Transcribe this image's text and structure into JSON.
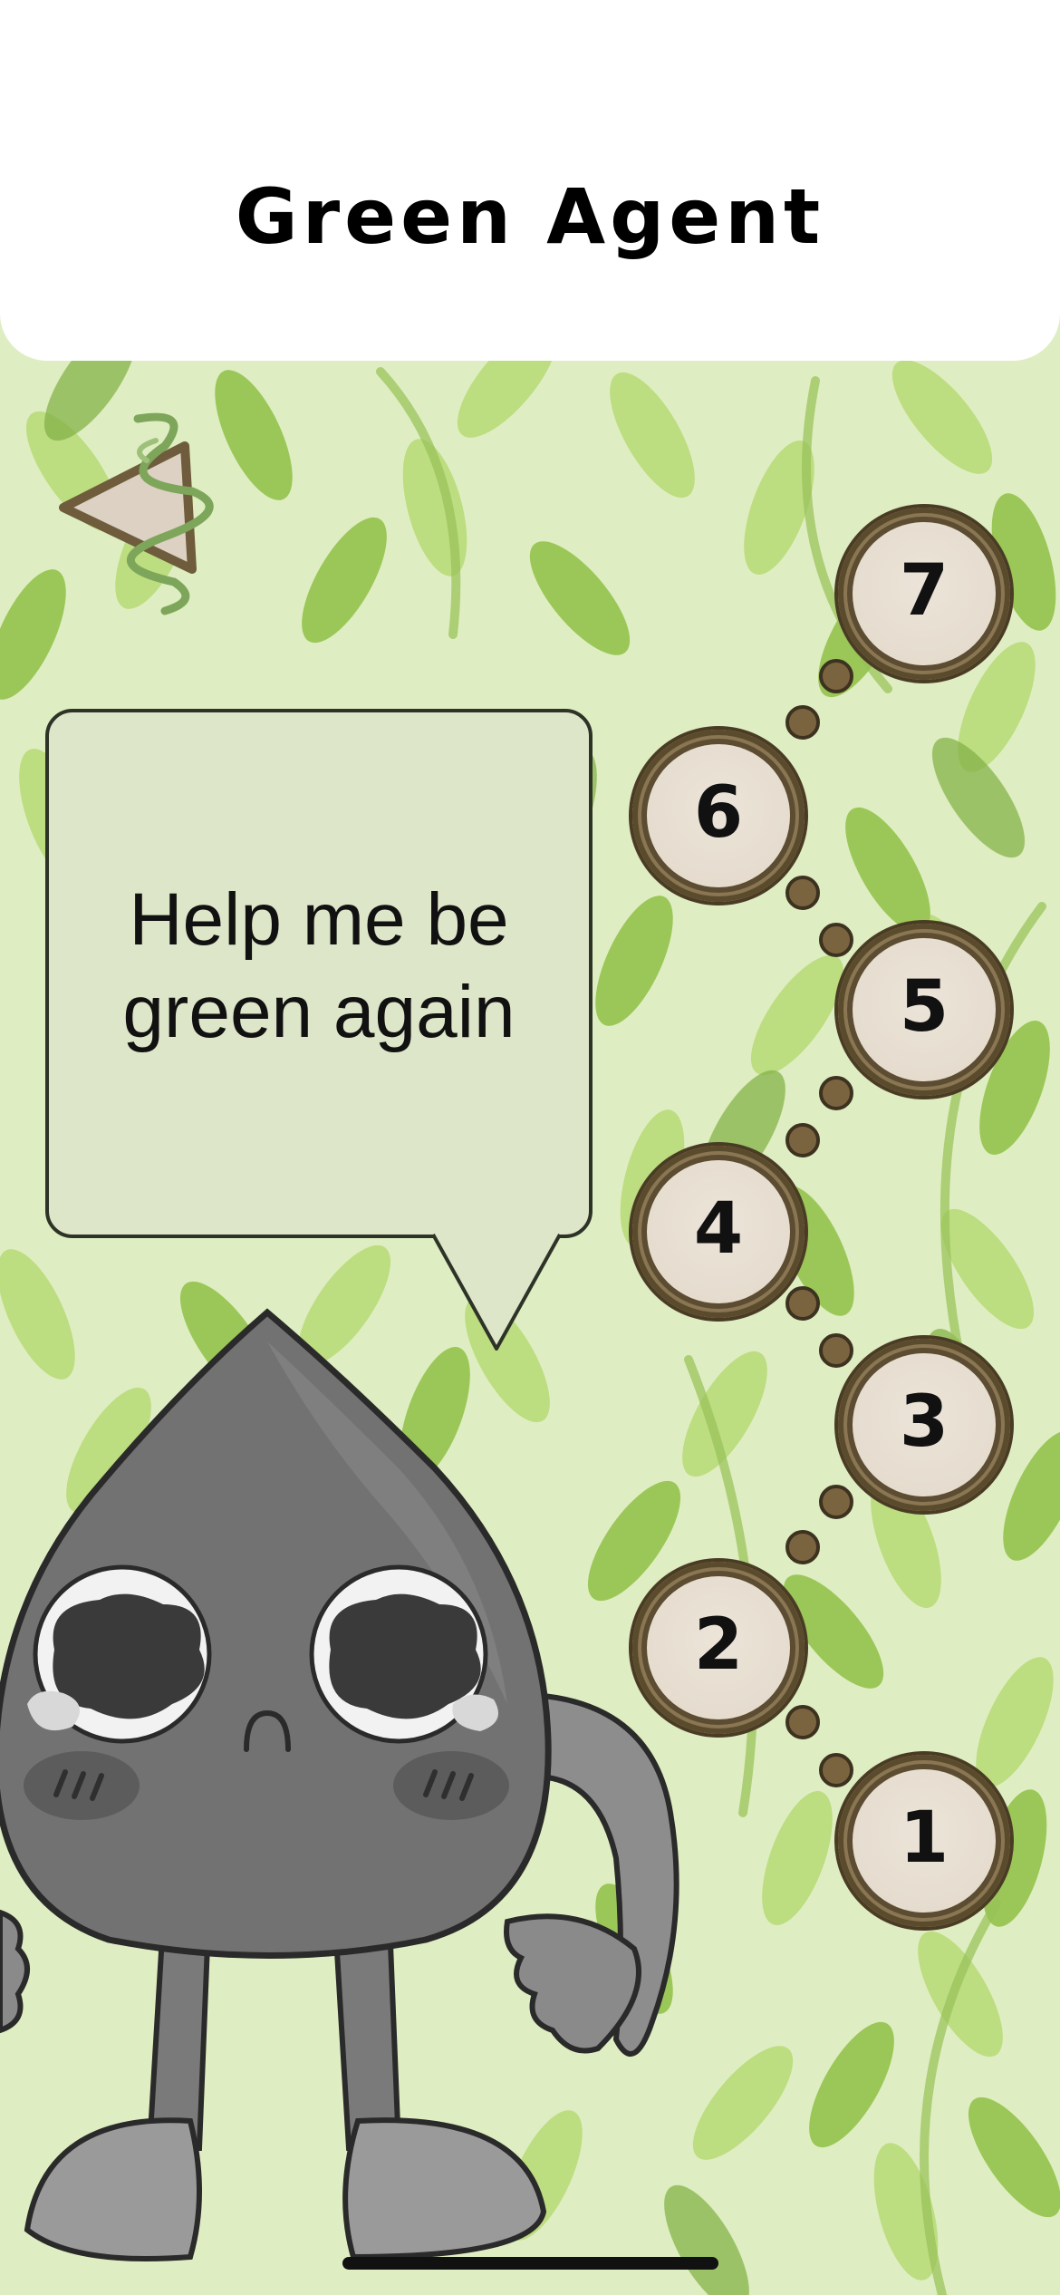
{
  "header": {
    "title": "Green Agent"
  },
  "back_button": {
    "icon": "triangle-back-icon"
  },
  "levels": [
    {
      "number": "1",
      "state": "available"
    },
    {
      "number": "2",
      "state": "available"
    },
    {
      "number": "3",
      "state": "available"
    },
    {
      "number": "4",
      "state": "available"
    },
    {
      "number": "5",
      "state": "available"
    },
    {
      "number": "6",
      "state": "available"
    },
    {
      "number": "7",
      "state": "available"
    }
  ],
  "speech_bubble": {
    "line1": "Help me be",
    "line2": "green again"
  },
  "character": {
    "name": "sad-oil-drop-character",
    "mood": "sad"
  },
  "colors": {
    "background": "#dfeec2",
    "leaf_light": "#a9d35a",
    "leaf_dark": "#7fae3a",
    "level_fill": "#e4dbcd",
    "level_border": "#5c4c31",
    "bubble_fill": "#dde6c8",
    "character_body": "#6f6f6f"
  }
}
